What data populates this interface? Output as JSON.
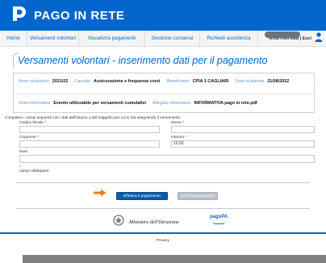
{
  "brand": {
    "name": "PAGO IN RETE",
    "color": "#0066cc",
    "logo_icon": "pagoinrete-logo-icon"
  },
  "nav": {
    "items": [
      {
        "label": "Home"
      },
      {
        "label": "Versamenti volontari"
      },
      {
        "label": "Visualizza pagamenti"
      },
      {
        "label": "Gestione consensi"
      },
      {
        "label": "Richiedi assistenza"
      }
    ],
    "user_area": "Area riservata | Esci",
    "user_icon": "user-icon"
  },
  "page": {
    "title": "Versamenti volontari - inserimento dati per il pagamento"
  },
  "info": {
    "anno_label": "Anno scolastico",
    "anno_value": "2021/22",
    "causale_label": "Causale",
    "causale_value": "Assicurazione e frequenza corsi",
    "beneficiario_label": "Beneficiario",
    "beneficiario_value": "CPIA 1 CAGLIARI",
    "scadenza_label": "Data scadenza",
    "scadenza_value": "21/08/2022",
    "nota_label": "Nota informativa",
    "nota_value": "Evento utilizzabile per versamenti cumulativi",
    "allegato_label": "Allegato informativa",
    "allegato_value": "INFORMATIVA pago in rete.pdf"
  },
  "form": {
    "instructions": "Compilare i campi seguenti con i dati dell'alunno o del soggetto per cui si sta eseguendo il versamento.",
    "codice_fiscale_label": "Codice fiscale *",
    "codice_fiscale_value": "",
    "nome_label": "Nome *",
    "nome_value": "",
    "cognome_label": "Cognome *",
    "cognome_value": "",
    "importo_label": "Importo *",
    "importo_value": "10,00",
    "note_label": "Note",
    "note_value": "",
    "required_star": "*",
    "required_note": "campi obbligatori."
  },
  "actions": {
    "submit_label": "Effettua il pagamento",
    "cancel_label": "Annulla pagamento",
    "arrow_color": "#f07c1a"
  },
  "footer": {
    "ministry": "Ministero dell'Istruzione",
    "pagopa": "pagoPA",
    "privacy": "Privacy"
  }
}
